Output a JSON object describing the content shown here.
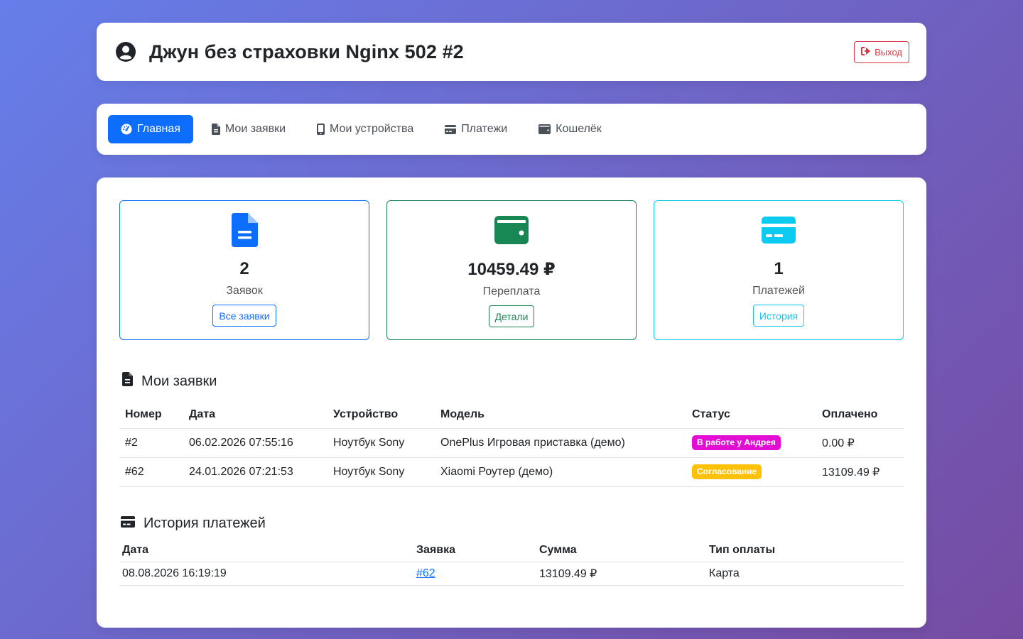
{
  "header": {
    "title": "Джун без страховки Nginx 502 #2",
    "user_icon": "user-circle-icon",
    "logout_label": "Выход",
    "logout_icon": "sign-out-icon"
  },
  "nav": {
    "items": [
      {
        "label": "Главная",
        "icon": "gauge-icon",
        "active": true
      },
      {
        "label": "Мои заявки",
        "icon": "file-icon",
        "active": false
      },
      {
        "label": "Мои устройства",
        "icon": "mobile-icon",
        "active": false
      },
      {
        "label": "Платежи",
        "icon": "credit-card-icon",
        "active": false
      },
      {
        "label": "Кошелёк",
        "icon": "wallet-icon",
        "active": false
      }
    ]
  },
  "stats": [
    {
      "value": "2",
      "label": "Заявок",
      "button": "Все заявки",
      "icon": "file-icon",
      "color": "#0d6efd"
    },
    {
      "value": "10459.49 ₽",
      "label": "Переплата",
      "button": "Детали",
      "icon": "wallet-icon",
      "color": "#198754"
    },
    {
      "value": "1",
      "label": "Платежей",
      "button": "История",
      "icon": "credit-card-icon",
      "color": "#0dcaf0"
    }
  ],
  "orders": {
    "title": "Мои заявки",
    "columns": [
      "Номер",
      "Дата",
      "Устройство",
      "Модель",
      "Статус",
      "Оплачено"
    ],
    "rows": [
      {
        "number": "#2",
        "date": "06.02.2026 07:55:16",
        "device": "Ноутбук Sony",
        "model": "OnePlus Игровая приставка (демо)",
        "status": "В работе у Андрея",
        "status_color": "#e20ed4",
        "paid": "0.00 ₽"
      },
      {
        "number": "#62",
        "date": "24.01.2026 07:21:53",
        "device": "Ноутбук Sony",
        "model": "Xiaomi Роутер (демо)",
        "status": "Согласование",
        "status_color": "#ffc107",
        "paid": "13109.49 ₽"
      }
    ]
  },
  "payments": {
    "title": "История платежей",
    "columns": [
      "Дата",
      "Заявка",
      "Сумма",
      "Тип оплаты"
    ],
    "rows": [
      {
        "date": "08.08.2026 16:19:19",
        "order": "#62",
        "amount": "13109.49 ₽",
        "type": "Карта"
      }
    ]
  }
}
